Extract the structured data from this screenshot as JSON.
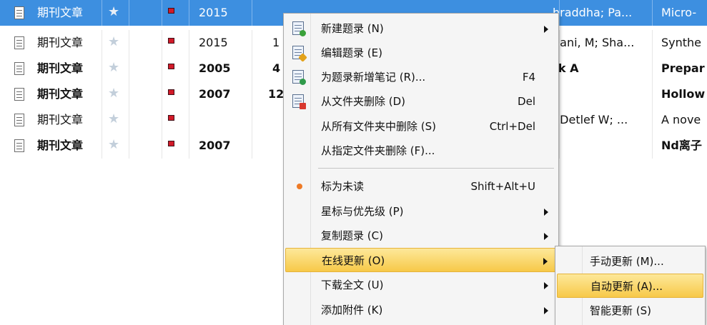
{
  "rows": [
    {
      "type": "期刊文章",
      "year": "2015",
      "c5": "",
      "authors": "hraddha; Pa...",
      "title": "Micro-",
      "selected": true,
      "bold": false
    },
    {
      "type": "期刊文章",
      "year": "2015",
      "c5": "1",
      "authors": "hani, M; Sha...",
      "title": "Synthe",
      "selected": false,
      "bold": false
    },
    {
      "type": "期刊文章",
      "year": "2005",
      "c5": "4",
      "authors": "rk A",
      "title": "Prepar",
      "selected": false,
      "bold": true
    },
    {
      "type": "期刊文章",
      "year": "2007",
      "c5": "12",
      "authors": "",
      "title": "Hollow",
      "selected": false,
      "bold": true
    },
    {
      "type": "期刊文章",
      "year": "",
      "c5": "",
      "authors": ", Detlef W; ...",
      "title": "A nove",
      "selected": false,
      "bold": false
    },
    {
      "type": "期刊文章",
      "year": "2007",
      "c5": "",
      "authors": "",
      "title": "Nd离子",
      "selected": false,
      "bold": true
    }
  ],
  "menu": {
    "new_record": {
      "label": "新建题录 (N)"
    },
    "edit_record": {
      "label": "编辑题录 (E)"
    },
    "add_note": {
      "label": "为题录新增笔记 (R)...",
      "shortcut": "F4"
    },
    "delete_from_folder": {
      "label": "从文件夹删除 (D)",
      "shortcut": "Del"
    },
    "delete_from_all": {
      "label": "从所有文件夹中删除 (S)",
      "shortcut": "Ctrl+Del"
    },
    "delete_from_specified": {
      "label": "从指定文件夹删除 (F)..."
    },
    "mark_unread": {
      "label": "标为未读",
      "shortcut": "Shift+Alt+U"
    },
    "star_priority": {
      "label": "星标与优先级 (P)"
    },
    "copy_record": {
      "label": "复制题录 (C)"
    },
    "online_update": {
      "label": "在线更新 (O)"
    },
    "download_fulltext": {
      "label": "下载全文 (U)"
    },
    "add_attachment": {
      "label": "添加附件 (K)"
    }
  },
  "submenu": {
    "manual_update": {
      "label": "手动更新 (M)..."
    },
    "auto_update": {
      "label": "自动更新 (A)..."
    },
    "smart_update": {
      "label": "智能更新 (S)"
    }
  },
  "colors": {
    "selection": "#3d8fe0",
    "menu_highlight": "#f7c948",
    "priority_flag": "#d21a28",
    "unread_dot": "#ee7a26"
  },
  "icons": {
    "document": "document-icon",
    "star": "star-icon",
    "priority": "priority-flag-icon"
  }
}
